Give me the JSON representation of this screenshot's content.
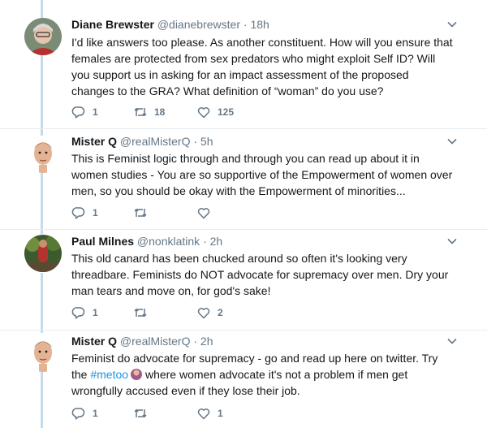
{
  "tweets": [
    {
      "name": "Diane Brewster",
      "handle": "@dianebrewster",
      "dot": "·",
      "time": "18h",
      "text": "I'd like answers too please. As another constituent. How will you ensure that females are protected from sex predators who might exploit Self ID? Will you support us in asking for an impact assessment of the proposed changes to the GRA? What definition of “woman” do you use?",
      "replies": "1",
      "retweets": "18",
      "likes": "125"
    },
    {
      "name": "Mister Q",
      "handle": "@realMisterQ",
      "dot": "·",
      "time": "5h",
      "text": "This is Feminist logic through and through you can read up about it in women studies - You are so supportive of the Empowerment of women over men, so you should be okay with the Empowerment of minorities...",
      "replies": "1",
      "retweets": "",
      "likes": ""
    },
    {
      "name": "Paul Milnes",
      "handle": "@nonklatink",
      "dot": "·",
      "time": "2h",
      "text": "This old canard has been chucked around so often it's looking very threadbare. Feminists do NOT advocate for supremacy over men. Dry your man tears and move on, for god's sake!",
      "replies": "1",
      "retweets": "",
      "likes": "2"
    },
    {
      "name": "Mister Q",
      "handle": "@realMisterQ",
      "dot": "·",
      "time": "2h",
      "text_before": "Feminist do advocate for supremacy - go and read up here on twitter. Try the ",
      "hashtag": "#metoo",
      "text_after": " where women advocate it's not a problem if men get wrongfully accused even if they lose their job.",
      "replies": "1",
      "retweets": "",
      "likes": "1"
    }
  ],
  "colors": {
    "thread": "#c4dbe9",
    "link": "#1b95e0",
    "muted": "#657786"
  },
  "icons": [
    "reply-icon",
    "retweet-icon",
    "heart-icon",
    "chevron-down-icon"
  ]
}
